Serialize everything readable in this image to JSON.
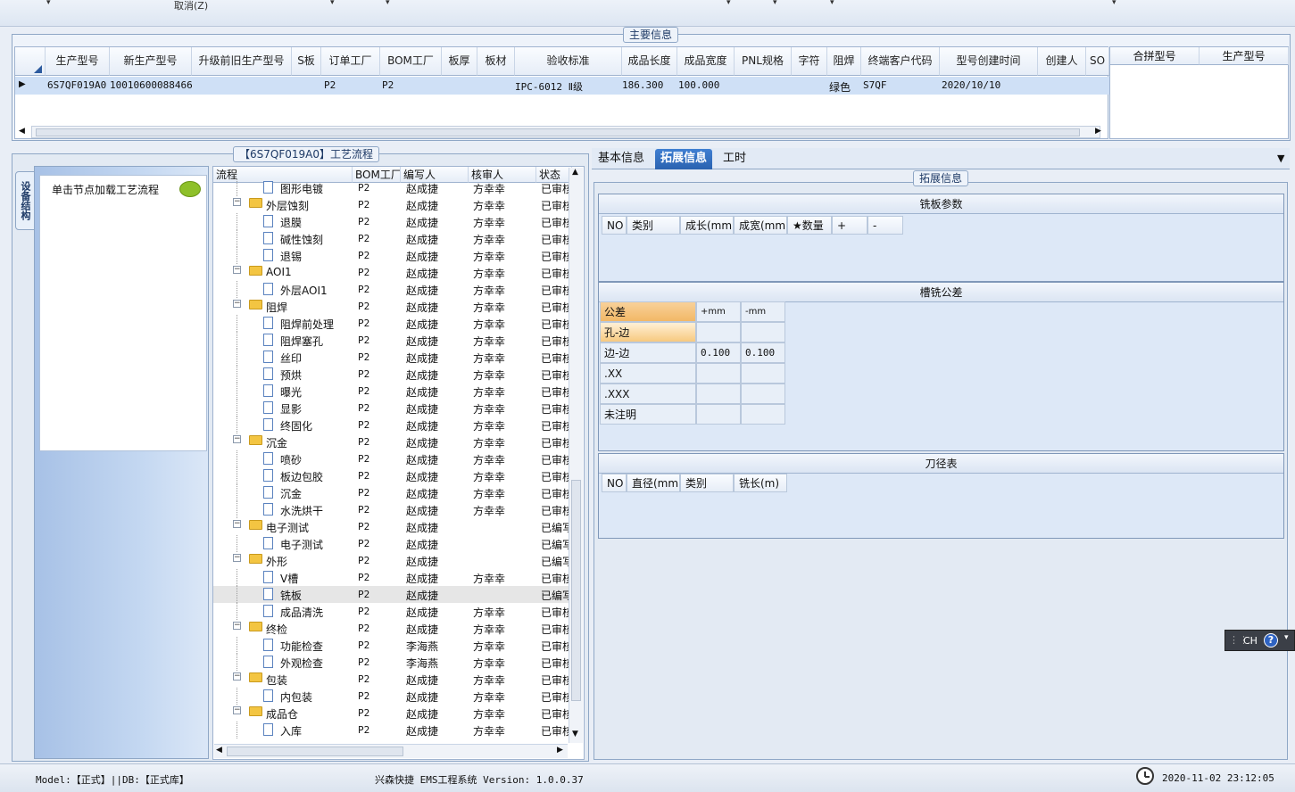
{
  "toolbar": {
    "cancel_label": "取消(Z)"
  },
  "main_info": {
    "title": "主要信息",
    "columns": [
      "生产型号",
      "新生产型号",
      "升级前旧生产型号",
      "S板",
      "订单工厂",
      "BOM工厂",
      "板厚",
      "板材",
      "验收标准",
      "成品长度",
      "成品宽度",
      "PNL规格",
      "字符",
      "阻焊",
      "终端客户代码",
      "型号创建时间",
      "创建人",
      "SO"
    ],
    "row": {
      "prod_model": "6S7QF019A0",
      "new_model": "10010600088466",
      "order_factory": "P2",
      "bom_factory": "P2",
      "standard": "IPC-6012 Ⅱ级",
      "length": "186.300",
      "width": "100.000",
      "solder_mask": "绿色",
      "customer_code": "S7QF",
      "created": "2020/10/10"
    },
    "right_columns": [
      "合拼型号",
      "生产型号"
    ]
  },
  "process": {
    "title": "【6S7QF019A0】工艺流程",
    "side_tab": "设备结构",
    "hint": "单击节点加载工艺流程",
    "columns": [
      "流程",
      "BOM工厂",
      "编写人",
      "核审人",
      "状态"
    ],
    "rows": [
      {
        "name": "图形电镀",
        "level": 2,
        "bom": "P2",
        "writer": "赵成捷",
        "reviewer": "方幸幸",
        "status": "已审核"
      },
      {
        "name": "外层蚀刻",
        "level": 1,
        "bom": "P2",
        "writer": "赵成捷",
        "reviewer": "方幸幸",
        "status": "已审核"
      },
      {
        "name": "退膜",
        "level": 2,
        "bom": "P2",
        "writer": "赵成捷",
        "reviewer": "方幸幸",
        "status": "已审核"
      },
      {
        "name": "碱性蚀刻",
        "level": 2,
        "bom": "P2",
        "writer": "赵成捷",
        "reviewer": "方幸幸",
        "status": "已审核"
      },
      {
        "name": "退锡",
        "level": 2,
        "bom": "P2",
        "writer": "赵成捷",
        "reviewer": "方幸幸",
        "status": "已审核"
      },
      {
        "name": "AOI1",
        "level": 1,
        "bom": "P2",
        "writer": "赵成捷",
        "reviewer": "方幸幸",
        "status": "已审核"
      },
      {
        "name": "外层AOI1",
        "level": 2,
        "bom": "P2",
        "writer": "赵成捷",
        "reviewer": "方幸幸",
        "status": "已审核"
      },
      {
        "name": "阻焊",
        "level": 1,
        "bom": "P2",
        "writer": "赵成捷",
        "reviewer": "方幸幸",
        "status": "已审核"
      },
      {
        "name": "阻焊前处理",
        "level": 2,
        "bom": "P2",
        "writer": "赵成捷",
        "reviewer": "方幸幸",
        "status": "已审核"
      },
      {
        "name": "阻焊塞孔",
        "level": 2,
        "bom": "P2",
        "writer": "赵成捷",
        "reviewer": "方幸幸",
        "status": "已审核"
      },
      {
        "name": "丝印",
        "level": 2,
        "bom": "P2",
        "writer": "赵成捷",
        "reviewer": "方幸幸",
        "status": "已审核"
      },
      {
        "name": "预烘",
        "level": 2,
        "bom": "P2",
        "writer": "赵成捷",
        "reviewer": "方幸幸",
        "status": "已审核"
      },
      {
        "name": "曝光",
        "level": 2,
        "bom": "P2",
        "writer": "赵成捷",
        "reviewer": "方幸幸",
        "status": "已审核"
      },
      {
        "name": "显影",
        "level": 2,
        "bom": "P2",
        "writer": "赵成捷",
        "reviewer": "方幸幸",
        "status": "已审核"
      },
      {
        "name": "终固化",
        "level": 2,
        "bom": "P2",
        "writer": "赵成捷",
        "reviewer": "方幸幸",
        "status": "已审核"
      },
      {
        "name": "沉金",
        "level": 1,
        "bom": "P2",
        "writer": "赵成捷",
        "reviewer": "方幸幸",
        "status": "已审核"
      },
      {
        "name": "喷砂",
        "level": 2,
        "bom": "P2",
        "writer": "赵成捷",
        "reviewer": "方幸幸",
        "status": "已审核"
      },
      {
        "name": "板边包胶",
        "level": 2,
        "bom": "P2",
        "writer": "赵成捷",
        "reviewer": "方幸幸",
        "status": "已审核"
      },
      {
        "name": "沉金",
        "level": 2,
        "bom": "P2",
        "writer": "赵成捷",
        "reviewer": "方幸幸",
        "status": "已审核"
      },
      {
        "name": "水洗烘干",
        "level": 2,
        "bom": "P2",
        "writer": "赵成捷",
        "reviewer": "方幸幸",
        "status": "已审核"
      },
      {
        "name": "电子测试",
        "level": 1,
        "bom": "P2",
        "writer": "赵成捷",
        "reviewer": "",
        "status": "已编写"
      },
      {
        "name": "电子测试",
        "level": 2,
        "bom": "P2",
        "writer": "赵成捷",
        "reviewer": "",
        "status": "已编写"
      },
      {
        "name": "外形",
        "level": 1,
        "bom": "P2",
        "writer": "赵成捷",
        "reviewer": "",
        "status": "已编写"
      },
      {
        "name": "V槽",
        "level": 2,
        "bom": "P2",
        "writer": "赵成捷",
        "reviewer": "方幸幸",
        "status": "已审核"
      },
      {
        "name": "铣板",
        "level": 2,
        "bom": "P2",
        "writer": "赵成捷",
        "reviewer": "",
        "status": "已编写",
        "selected": true
      },
      {
        "name": "成品清洗",
        "level": 2,
        "bom": "P2",
        "writer": "赵成捷",
        "reviewer": "方幸幸",
        "status": "已审核"
      },
      {
        "name": "终检",
        "level": 1,
        "bom": "P2",
        "writer": "赵成捷",
        "reviewer": "方幸幸",
        "status": "已审核"
      },
      {
        "name": "功能检查",
        "level": 2,
        "bom": "P2",
        "writer": "李海燕",
        "reviewer": "方幸幸",
        "status": "已审核"
      },
      {
        "name": "外观检查",
        "level": 2,
        "bom": "P2",
        "writer": "李海燕",
        "reviewer": "方幸幸",
        "status": "已审核"
      },
      {
        "name": "包装",
        "level": 1,
        "bom": "P2",
        "writer": "赵成捷",
        "reviewer": "方幸幸",
        "status": "已审核"
      },
      {
        "name": "内包装",
        "level": 2,
        "bom": "P2",
        "writer": "赵成捷",
        "reviewer": "方幸幸",
        "status": "已审核"
      },
      {
        "name": "成品仓",
        "level": 1,
        "bom": "P2",
        "writer": "赵成捷",
        "reviewer": "方幸幸",
        "status": "已审核"
      },
      {
        "name": "入库",
        "level": 2,
        "bom": "P2",
        "writer": "赵成捷",
        "reviewer": "方幸幸",
        "status": "已审核"
      }
    ]
  },
  "tabs": [
    "基本信息",
    "拓展信息",
    "工时"
  ],
  "ext": {
    "title": "拓展信息",
    "milling": {
      "title": "铣板参数",
      "columns": [
        "NO",
        "类别",
        "成长(mm)",
        "成宽(mm)",
        "★数量",
        "+",
        "-"
      ]
    },
    "slot": {
      "title": "槽铣公差",
      "columns": [
        "公差",
        "+mm",
        "-mm"
      ],
      "rows": [
        {
          "label": "孔-边",
          "plus": "",
          "minus": ""
        },
        {
          "label": "边-边",
          "plus": "0.100",
          "minus": "0.100"
        },
        {
          "label": ".XX",
          "plus": "",
          "minus": ""
        },
        {
          "label": ".XXX",
          "plus": "",
          "minus": ""
        },
        {
          "label": "未注明",
          "plus": "",
          "minus": ""
        }
      ]
    },
    "tool": {
      "title": "刀径表",
      "columns": [
        "NO",
        "直径(mm)",
        "类别",
        "铣长(m)"
      ]
    }
  },
  "status": {
    "model": "Model:【正式】||DB:【正式库】",
    "system": "兴森快捷 EMS工程系统 Version: 1.0.0.37",
    "datetime": "2020-11-02 23:12:05"
  },
  "ime": {
    "lang": "CH",
    "help": "?"
  }
}
